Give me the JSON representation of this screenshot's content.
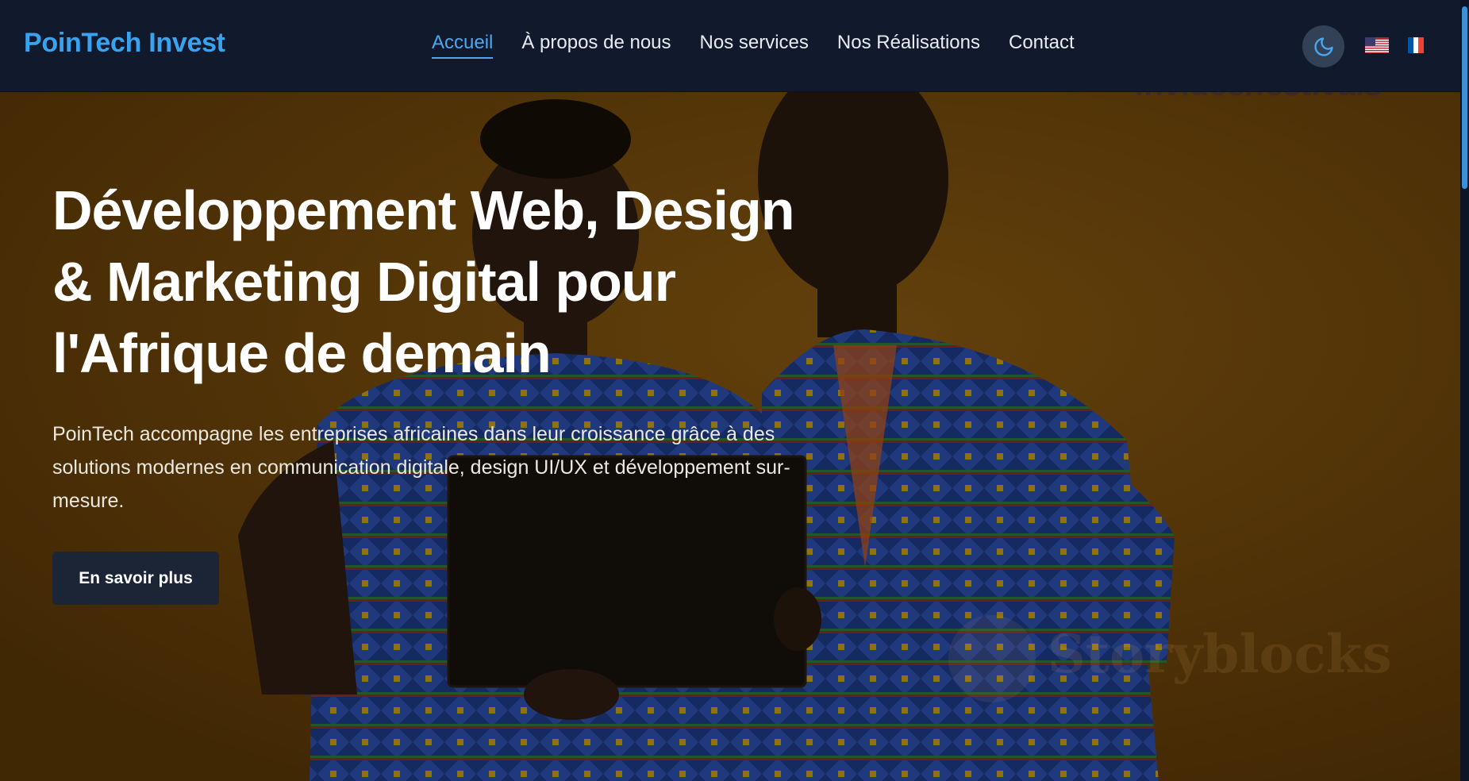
{
  "navbar": {
    "brand": "PoinTech Invest",
    "links": [
      {
        "label": "Accueil",
        "active": true
      },
      {
        "label": "À propos de nous",
        "active": false
      },
      {
        "label": "Nos services",
        "active": false
      },
      {
        "label": "Nos Réalisations",
        "active": false
      },
      {
        "label": "Contact",
        "active": false
      }
    ],
    "theme_toggle_icon": "moon-icon",
    "languages": [
      {
        "icon": "us-flag-icon",
        "code": "en"
      },
      {
        "icon": "fr-flag-icon",
        "code": "fr"
      }
    ]
  },
  "hero": {
    "title_lines": [
      "Développement Web, Design",
      "& Marketing Digital pour",
      "l'Afrique de demain"
    ],
    "subtitle": "PoinTech accompagne les entreprises africaines dans leur croissance grâce à des solutions modernes en communication digitale, design UI/UX et développement sur-mesure.",
    "cta_label": "En savoir plus",
    "watermark": "Storyblocks",
    "watermark_top": "invideo/festivals"
  },
  "colors": {
    "navbar_bg": "#111a2c",
    "accent": "#3aa3f0",
    "hero_bg": "#6b4308",
    "cta_bg": "#1b2536"
  }
}
